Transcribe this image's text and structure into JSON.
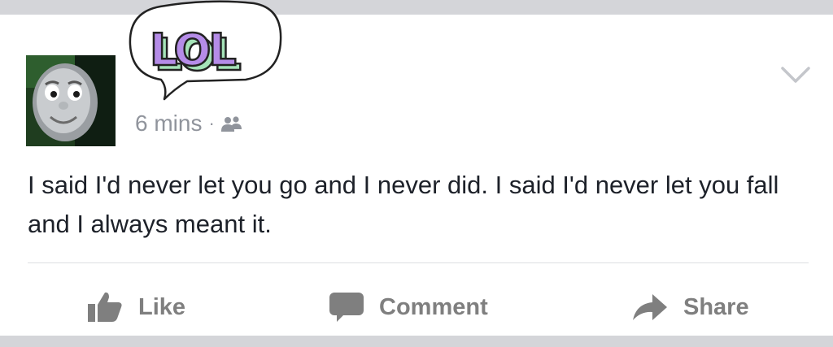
{
  "post": {
    "time": "6 mins",
    "separator": "·",
    "audience_icon": "friends-icon",
    "sticker_text": "LOL",
    "body": "I said I'd never let you go and I never did. I said I'd never let you fall and I always meant it."
  },
  "menu": {
    "icon": "chevron-down-icon"
  },
  "actions": {
    "like": "Like",
    "comment": "Comment",
    "share": "Share"
  },
  "colors": {
    "background": "#d4d5d9",
    "card": "#ffffff",
    "text": "#1d2129",
    "meta": "#90949c",
    "action": "#7f7f7f",
    "sticker_fill": "#b58ce8",
    "sticker_shadow": "#a5e3b8"
  }
}
